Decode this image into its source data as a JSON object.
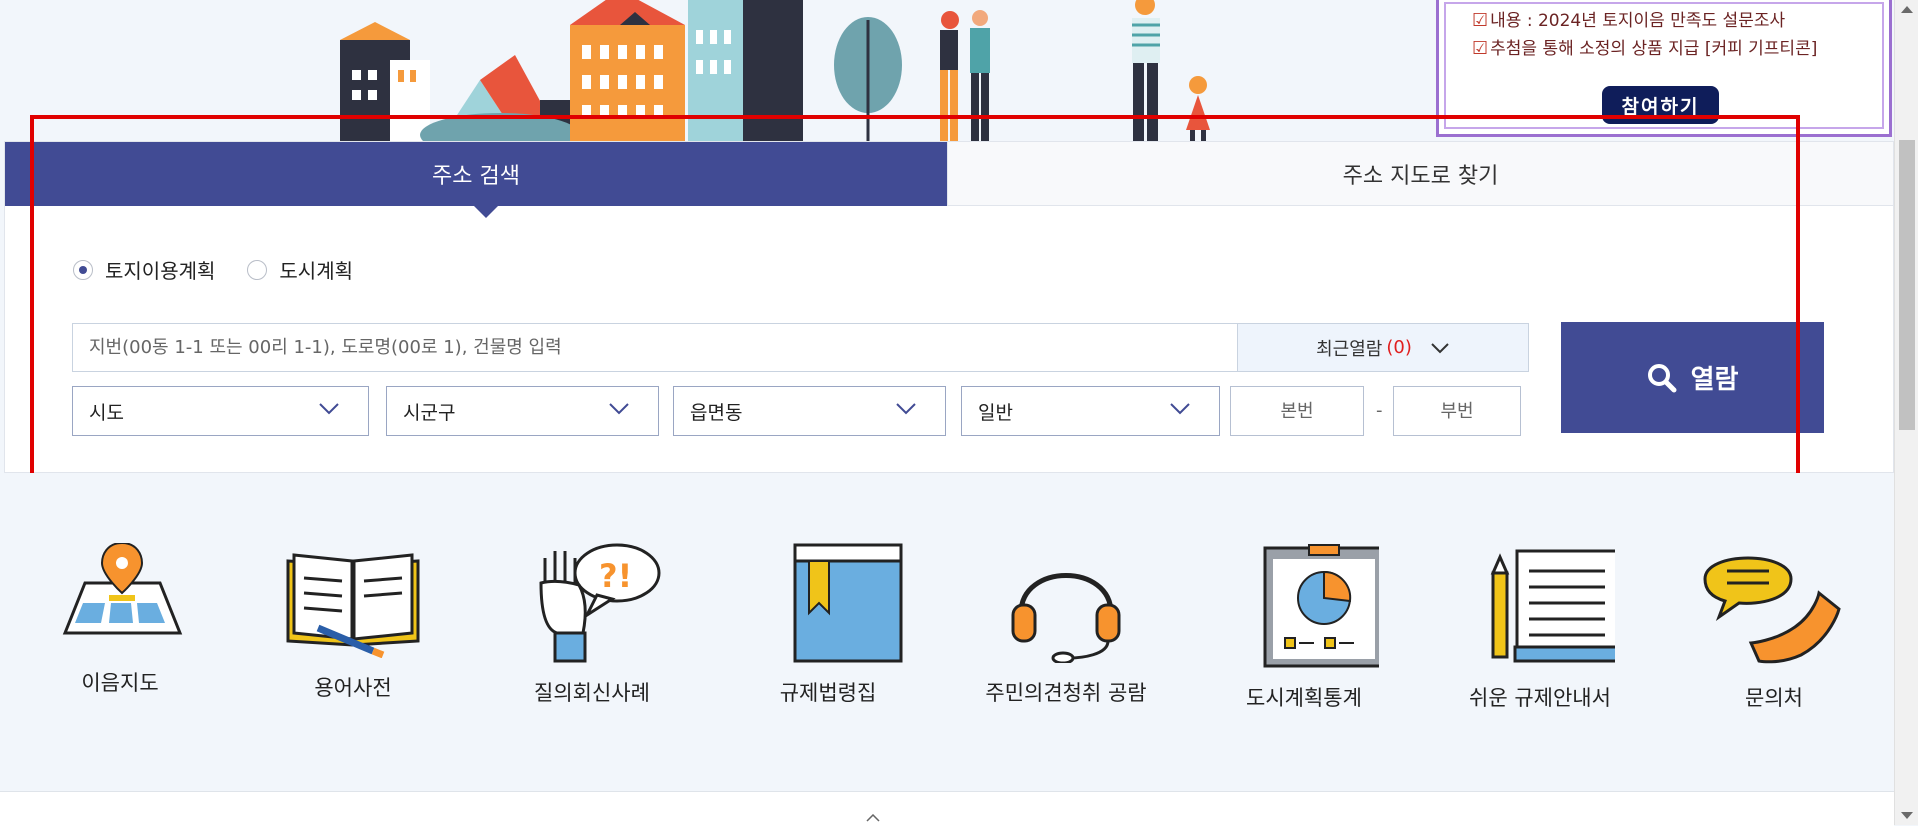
{
  "survey": {
    "line1": "내용 : 2024년 토지이음 만족도 설문조사",
    "line2": "추첨을 통해 소정의 상품 지급 [커피 기프티콘]",
    "button": "참여하기"
  },
  "tabs": {
    "address_search": "주소 검색",
    "map_search": "주소 지도로 찾기"
  },
  "radios": {
    "land_use": "토지이용계획",
    "urban_plan": "도시계획",
    "selected": "토지이용계획"
  },
  "search": {
    "placeholder": "지번(00동 1-1 또는 00리 1-1), 도로명(00로 1), 건물명 입력",
    "recent_label": "최근열람",
    "recent_count": "(0)",
    "sido": "시도",
    "sigungu": "시군구",
    "eupmyeondong": "읍면동",
    "type": "일반",
    "main_no_placeholder": "본번",
    "dash": "-",
    "sub_no_placeholder": "부번",
    "submit": "열람"
  },
  "quick_menu": [
    {
      "label": "이음지도",
      "icon": "map-pin-icon"
    },
    {
      "label": "용어사전",
      "icon": "open-book-icon"
    },
    {
      "label": "질의회신사례",
      "icon": "qna-hand-icon"
    },
    {
      "label": "규제법령집",
      "icon": "law-book-icon"
    },
    {
      "label": "주민의견청취 공람",
      "icon": "headset-icon"
    },
    {
      "label": "도시계획통계",
      "icon": "pie-chart-board-icon"
    },
    {
      "label": "쉬운 규제안내서",
      "icon": "guide-scroll-icon"
    },
    {
      "label": "문의처",
      "icon": "phone-chat-icon"
    }
  ],
  "colors": {
    "primary": "#414b94",
    "highlight": "#e00000",
    "count_red": "#e02020",
    "survey_border": "#9b6fd0"
  }
}
